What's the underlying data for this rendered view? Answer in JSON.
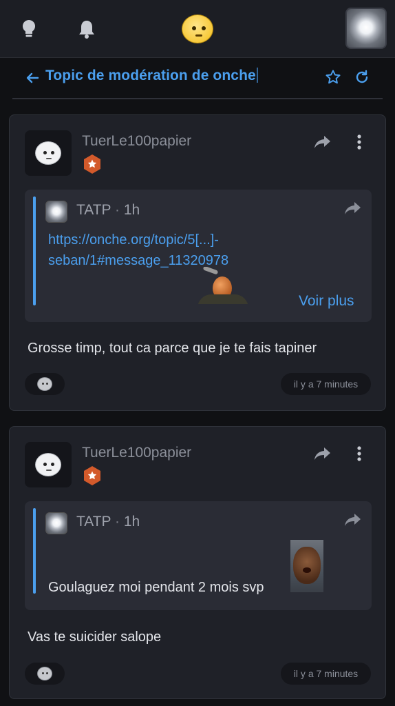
{
  "topbar": {
    "icons": [
      "lightbulb-icon",
      "bell-icon",
      "onche-logo",
      "user-avatar"
    ]
  },
  "topic": {
    "title": "Topic de modération de onche",
    "accent": "#4b9fee"
  },
  "posts": [
    {
      "author": "TuerLe100papier",
      "quote": {
        "author": "TATP",
        "time": "1h",
        "link": "https://onche.org/topic/5[...]-seban/1#message_11320978",
        "see_more": "Voir plus"
      },
      "body": "Grosse timp, tout ca parce que je te fais tapiner",
      "timestamp": "il y a 7 minutes"
    },
    {
      "author": "TuerLe100papier",
      "quote": {
        "author": "TATP",
        "time": "1h",
        "text": "Goulaguez moi pendant 2 mois svp"
      },
      "body": "Vas te suicider salope",
      "timestamp": "il y a 7 minutes"
    }
  ],
  "colors": {
    "background": "#101114",
    "card": "#1f2128",
    "quote": "#2a2c35",
    "link": "#4b9fee",
    "badge": "#d35a2b"
  }
}
